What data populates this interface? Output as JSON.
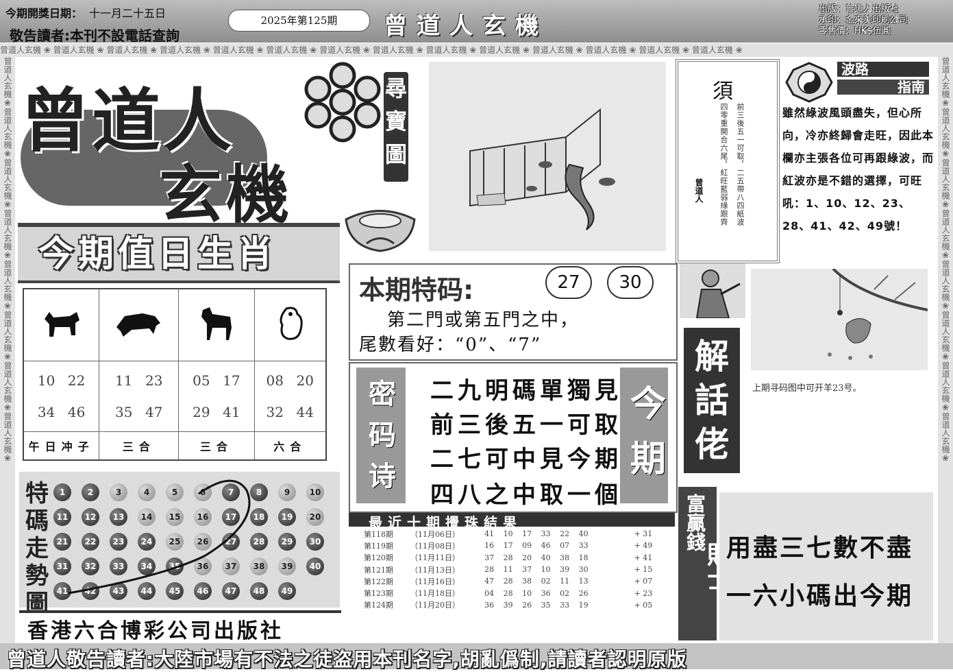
{
  "header": {
    "date_label": "今期開獎日期：",
    "date_value": "十一月二十五日",
    "notice": "敬告讀者:本刊不設電話查詢",
    "issue": "2025年第125期",
    "brand": "曾道人玄機",
    "publisher": "出版：曾道人出版社",
    "printer": "承印：金來美印刷公司",
    "price": "零售價：HK$伍圓"
  },
  "border_text": "曾道人玄機 ❀ 曾道人玄機 ❀ 曾道人玄機 ❀ 曾道人玄機 ❀ 曾道人玄機 ❀ 曾道人玄機 ❀ 曾道人玄機 ❀ 曾道人玄機 ❀ 曾道人玄機 ❀ 曾道人玄機 ❀ 曾道人玄機 ❀ 曾道人玄機 ❀ 曾道人玄機 ❀ 曾道人玄機 ❀",
  "border_text_v": "曾道人玄機❀曾道人玄機❀曾道人玄機❀曾道人玄機❀曾道人玄機❀曾道人玄機❀曾道人玄機❀曾道人玄機❀",
  "logo": {
    "main": "曾道人",
    "sub": "玄機",
    "treasure": "尋寶圖"
  },
  "zodiac": {
    "title": "今期值日生肖",
    "columns": [
      {
        "icon": "ox-icon",
        "numbers": [
          "10",
          "22",
          "34",
          "46"
        ],
        "relation": "午日冲子"
      },
      {
        "icon": "ox-icon",
        "numbers": [
          "11",
          "23",
          "35",
          "47"
        ],
        "relation": "三合"
      },
      {
        "icon": "horse-icon",
        "numbers": [
          "05",
          "17",
          "29",
          "41"
        ],
        "relation": "三合"
      },
      {
        "icon": "rat-icon",
        "numbers": [
          "08",
          "20",
          "32",
          "44"
        ],
        "relation": "六合"
      }
    ]
  },
  "trend": {
    "title": "特碼走勢圖",
    "rows": [
      [
        1,
        2,
        3,
        4,
        5,
        6,
        7,
        8,
        9,
        10
      ],
      [
        11,
        12,
        13,
        14,
        15,
        16,
        17,
        18,
        19,
        20
      ],
      [
        21,
        22,
        23,
        24,
        25,
        26,
        27,
        28,
        29,
        30
      ],
      [
        31,
        32,
        33,
        34,
        35,
        36,
        37,
        38,
        39,
        40
      ],
      [
        41,
        42,
        43,
        44,
        45,
        46,
        47,
        48,
        49
      ]
    ]
  },
  "company": "香港六合博彩公司出版社",
  "scroll": {
    "title": "須",
    "columns": [
      "前三後五一可取，二五帶八四紙波",
      "四零重開合六尾，紅旺藍弱綠跟齊"
    ],
    "signature": "曾道人"
  },
  "wave": {
    "title1": "波路",
    "title2": "指南",
    "text": "雖然綠波風頭盡失，但心所向，冷亦終歸會走旺，因此本欄亦主張各位可再跟綠波，而紅波亦是不錯的選擇，可旺吼：1、10、12、23、28、41、42、49號！"
  },
  "special": {
    "label": "本期特码:",
    "numbers": [
      "27",
      "30"
    ],
    "desc1": "第二門或第五門之中，",
    "desc2": "尾數看好：“0”、“7”"
  },
  "poem": {
    "tag": "密码诗",
    "lines": [
      "二九明碼單獨見",
      "前三後五一可取",
      "二七可中見今期",
      "四八之中取一個"
    ],
    "issue_tag": "今期"
  },
  "results": {
    "title": "最近十期攪珠結果",
    "rows": [
      {
        "period": "第118期",
        "date": "（11月06日）",
        "numbers": "41 10 17 33 22 40",
        "special": "+ 31"
      },
      {
        "period": "第119期",
        "date": "（11月08日）",
        "numbers": "16 17 09 46 07 33",
        "special": "+ 49"
      },
      {
        "period": "第120期",
        "date": "（11月11日）",
        "numbers": "37 28 20 40 38 18",
        "special": "+ 41"
      },
      {
        "period": "第121期",
        "date": "（11月13日）",
        "numbers": "28 11 37 10 39 30",
        "special": "+ 15"
      },
      {
        "period": "第122期",
        "date": "（11月16日）",
        "numbers": "47 28 38 02 11 13",
        "special": "+ 07"
      },
      {
        "period": "第123期",
        "date": "（11月18日）",
        "numbers": "04 28 10 36 02 26",
        "special": "+ 23"
      },
      {
        "period": "第124期",
        "date": "（11月20日）",
        "numbers": "36 39 26 35 33 19",
        "special": "+ 05"
      }
    ]
  },
  "explain": {
    "title": "解話佬",
    "caption": "上期寻码图中可开羊23号。"
  },
  "tips": {
    "tag1": "富贏錢",
    "tag2": "貼士",
    "line1": "用盡三七數不盡",
    "line2": "一六小碼出今期"
  },
  "footer": "曾道人敬告讀者:大陸市場有不法之徒盗用本刊名字,胡亂僞制,請讀者認明原版"
}
